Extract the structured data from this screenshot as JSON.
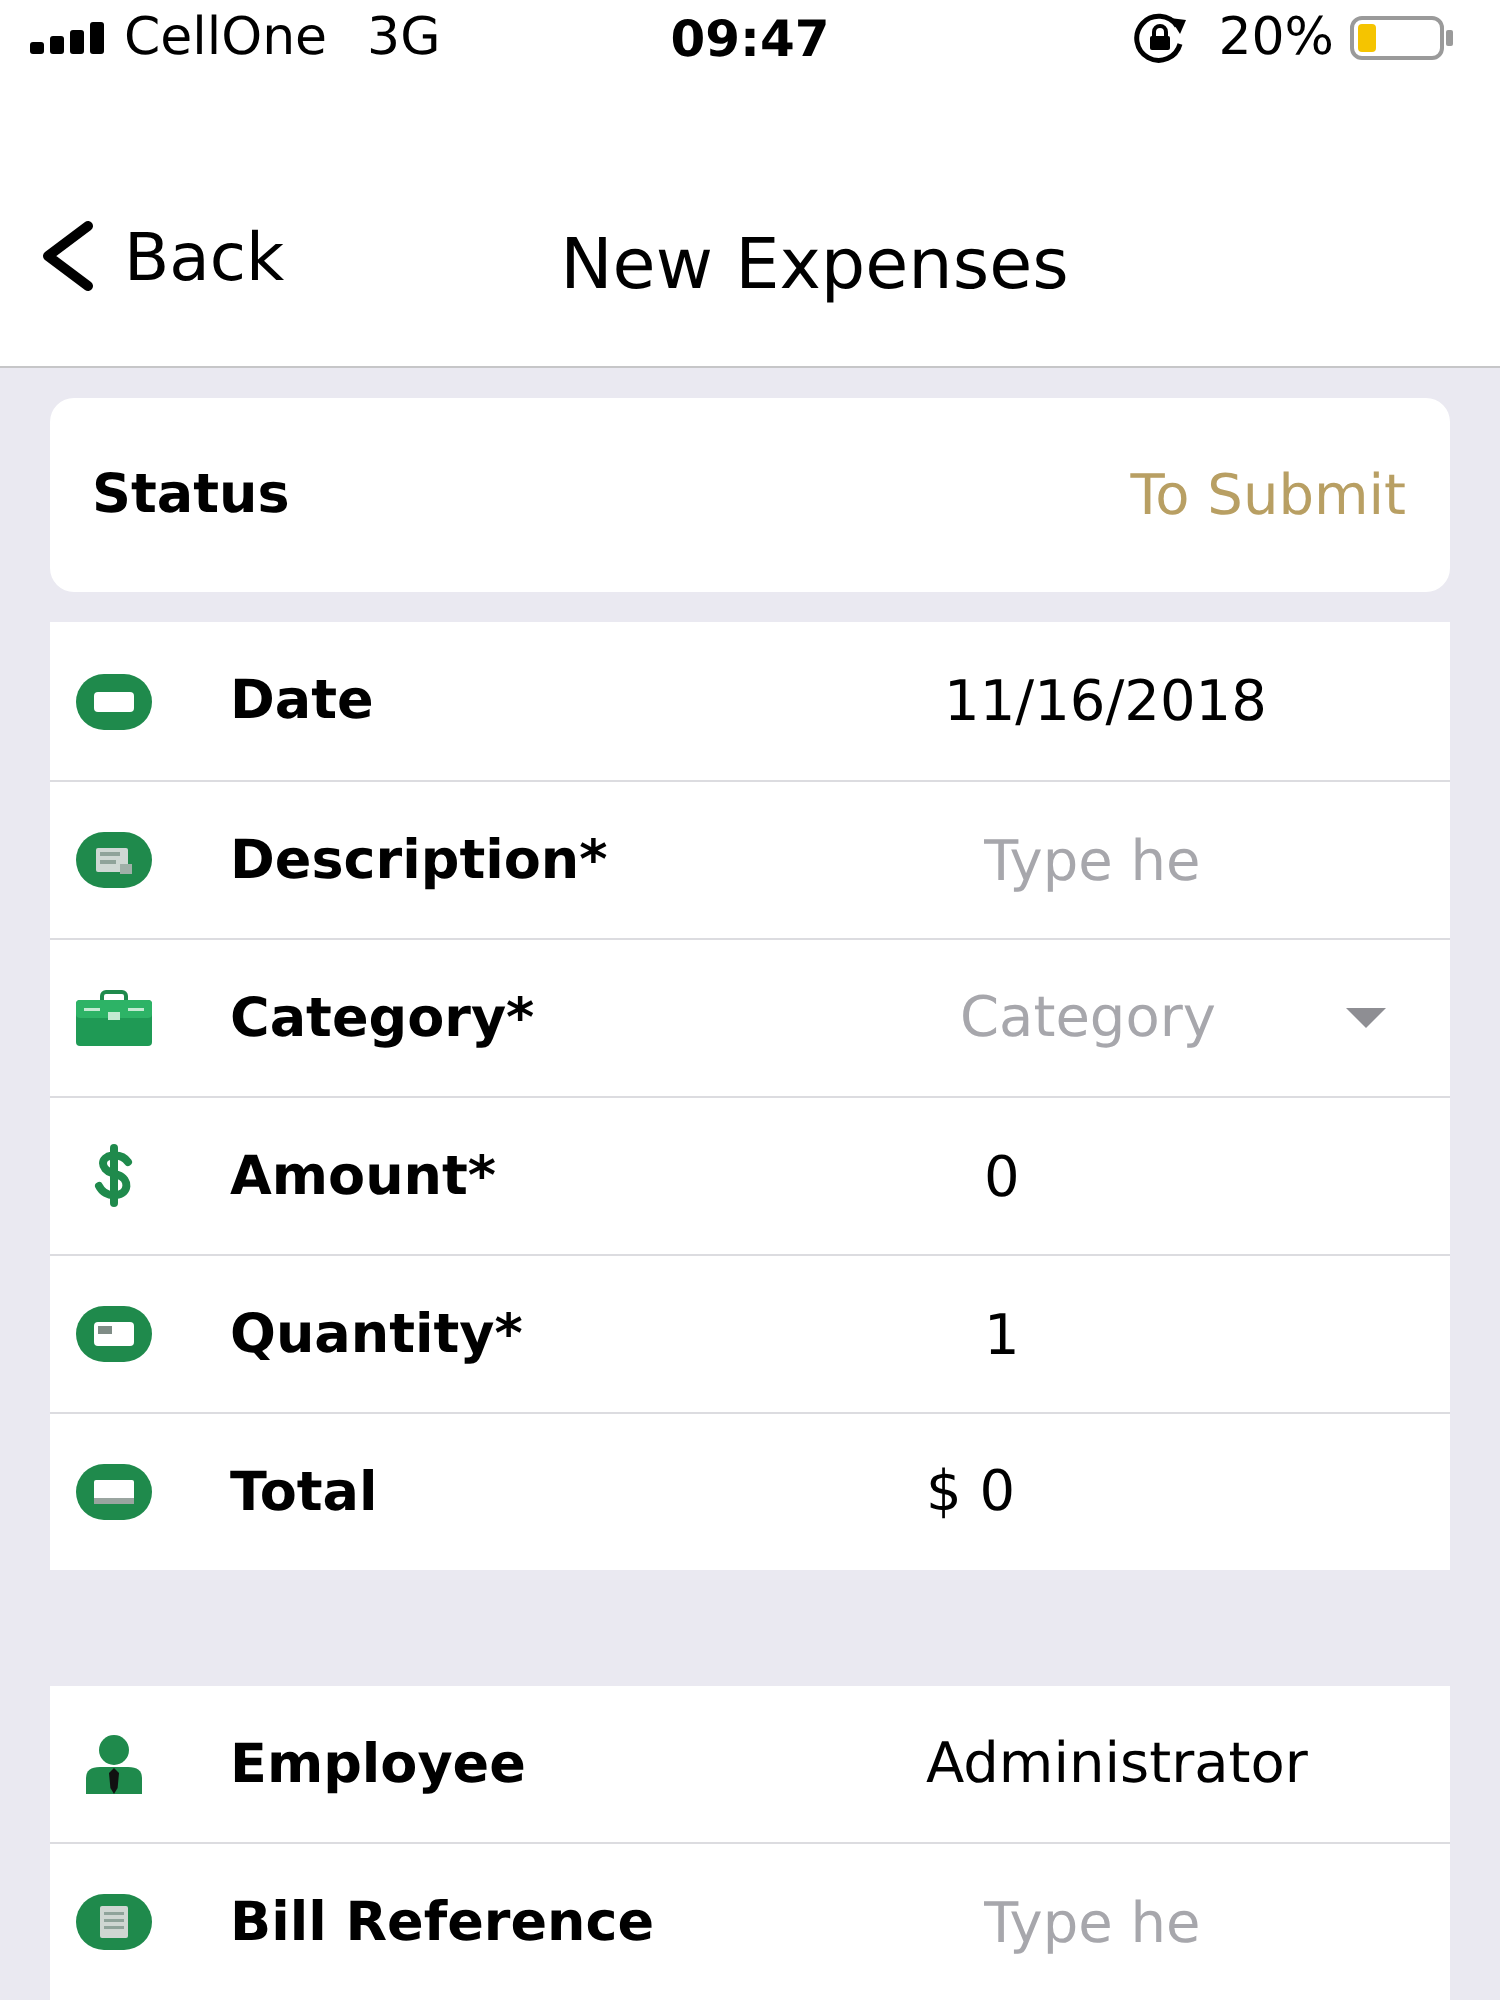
{
  "status_bar": {
    "carrier": "CellOne",
    "network": "3G",
    "time": "09:47",
    "battery": "20%"
  },
  "nav_bar": {
    "back": "Back",
    "title": "New Expenses"
  },
  "status_card": {
    "label": "Status",
    "value": "To Submit"
  },
  "groups": [
    {
      "rows": [
        {
          "kind": "date",
          "label": "Date",
          "value": "11/16/2018"
        },
        {
          "kind": "input",
          "label": "Description*",
          "placeholder": "Type he"
        },
        {
          "kind": "select",
          "label": "Category*",
          "placeholder": "Category"
        },
        {
          "kind": "input",
          "label": "Amount*",
          "value": "0"
        },
        {
          "kind": "input",
          "label": "Quantity*",
          "value": "1"
        },
        {
          "kind": "text",
          "label": "Total",
          "value": "$ 0"
        }
      ]
    },
    {
      "rows": [
        {
          "kind": "text",
          "label": "Employee",
          "value": "Administrator"
        },
        {
          "kind": "input",
          "label": "Bill Reference",
          "placeholder": "Type he"
        }
      ]
    }
  ]
}
